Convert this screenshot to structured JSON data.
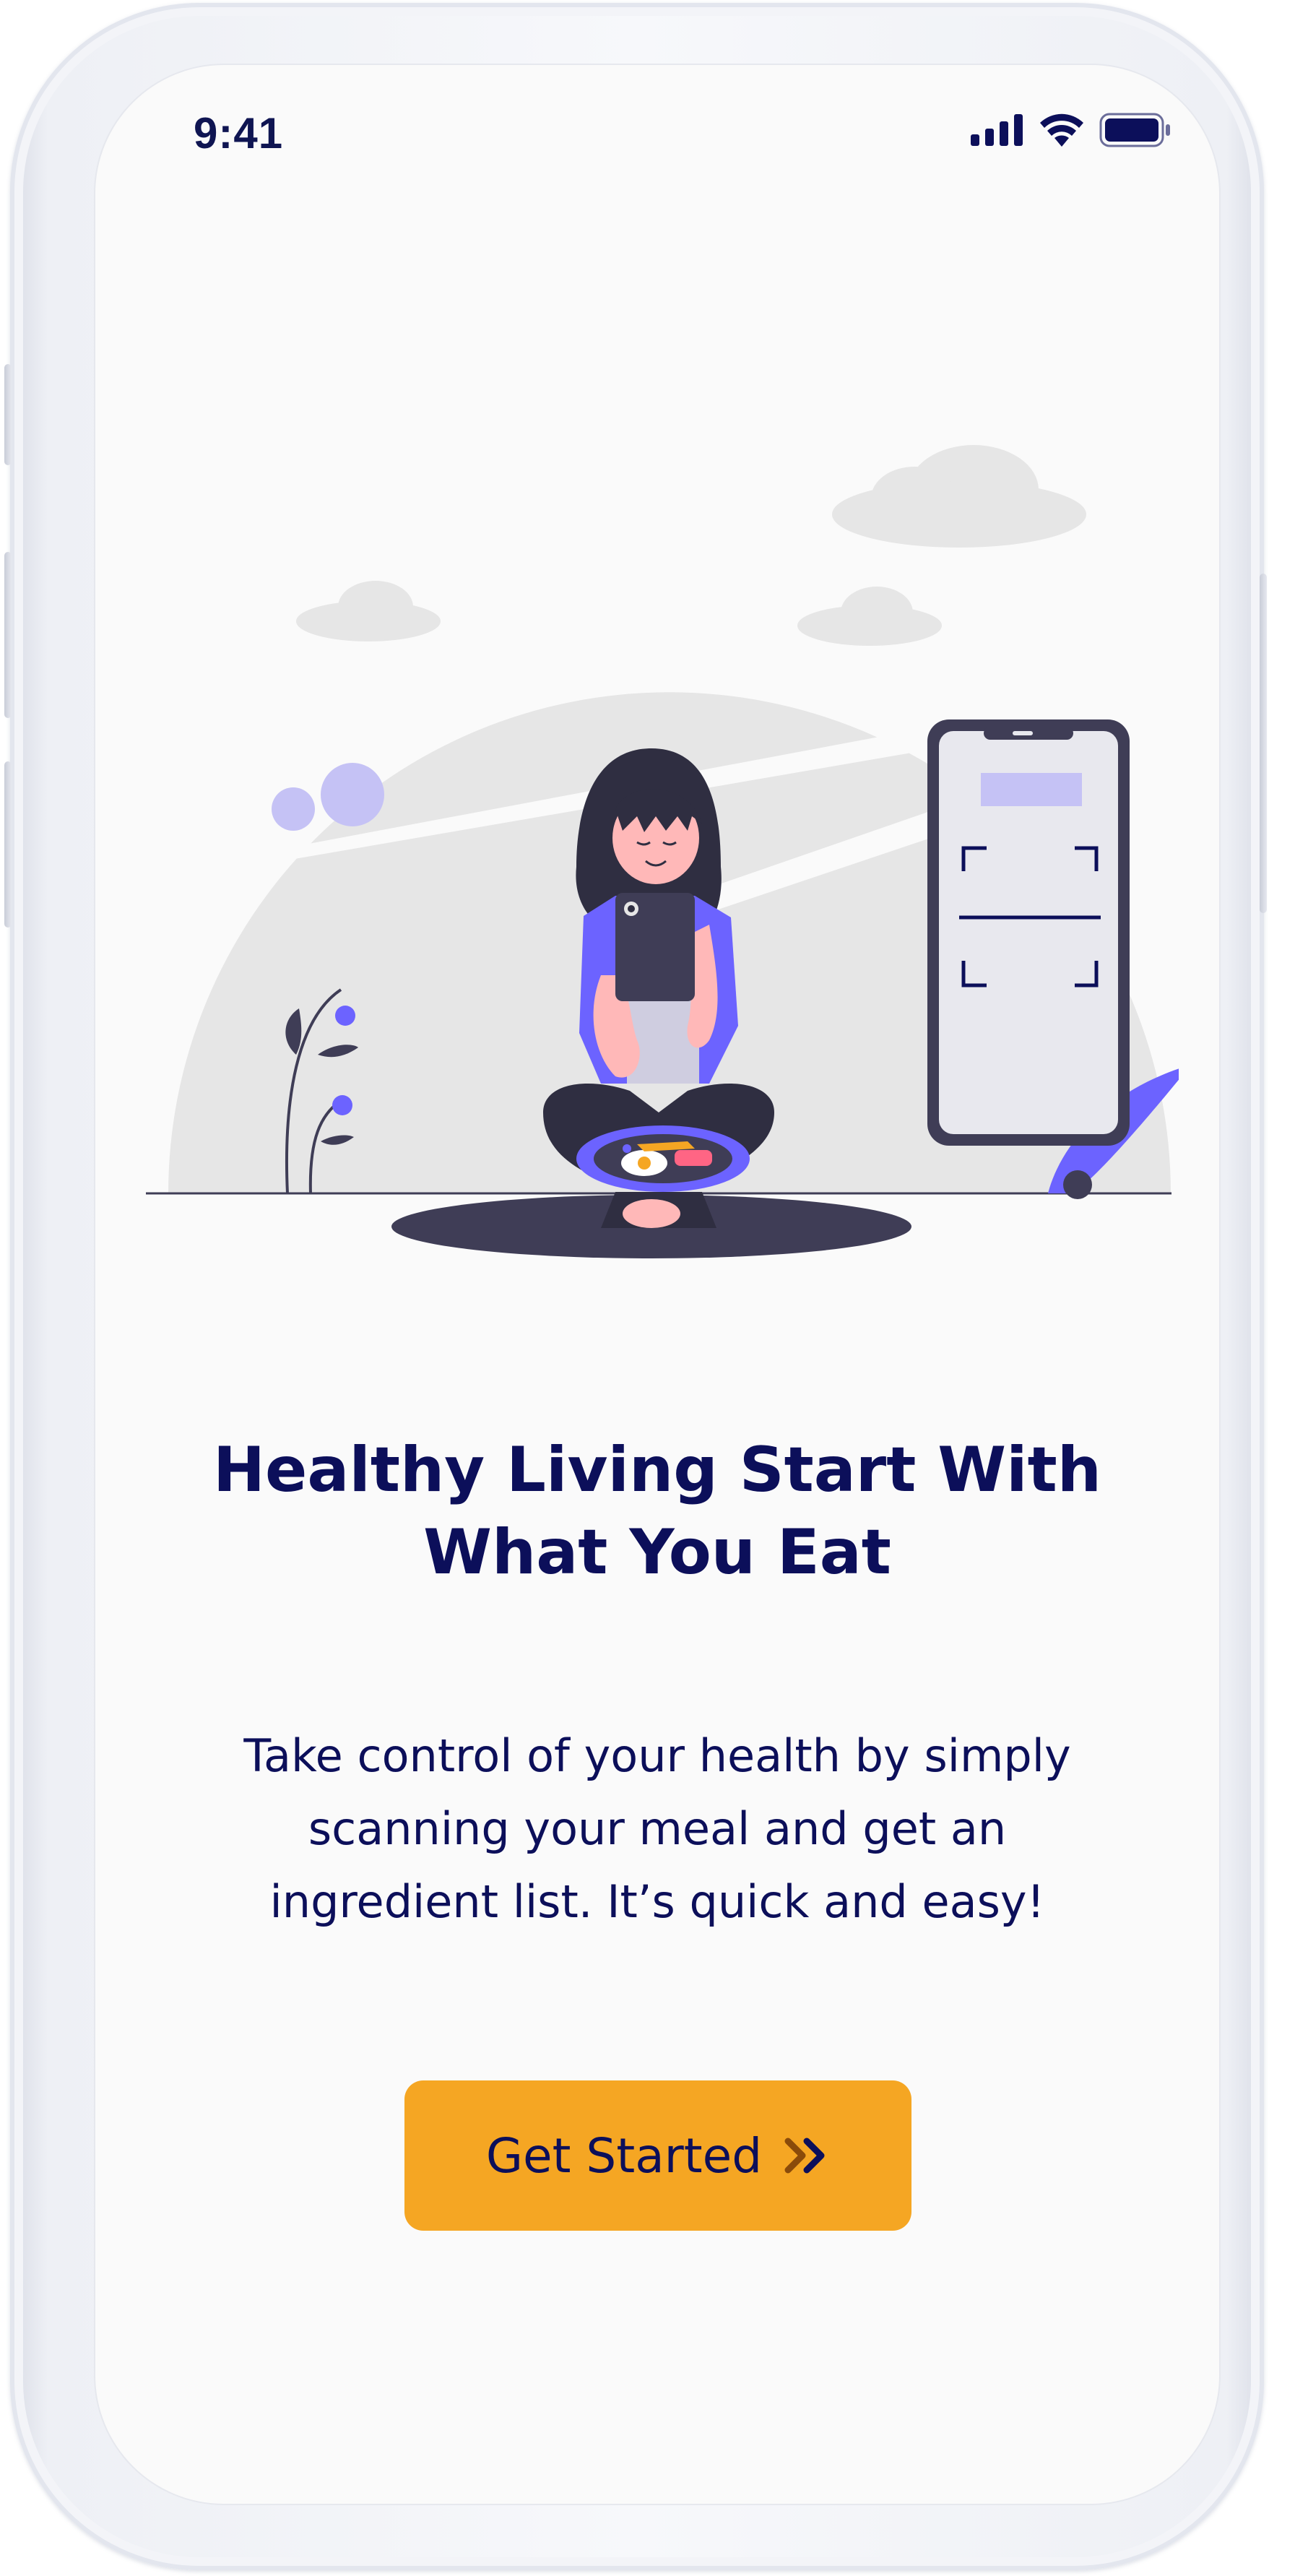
{
  "status_bar": {
    "time": "9:41"
  },
  "onboarding": {
    "headline_line1": "Healthy Living Start With",
    "headline_line2": "What You Eat",
    "description_line1": "Take control of your health by simply",
    "description_line2": "scanning your meal and get an",
    "description_line3": "ingredient list. It’s quick and easy!",
    "cta_label": "Get Started"
  },
  "icons": {
    "signal": "cellular-signal-icon",
    "wifi": "wifi-icon",
    "battery": "battery-icon",
    "cta_arrow": "double-chevron-right-icon"
  },
  "colors": {
    "text": "#0c0f5a",
    "accent": "#f5a623",
    "purple": "#6c63ff",
    "background": "#fafafa"
  }
}
